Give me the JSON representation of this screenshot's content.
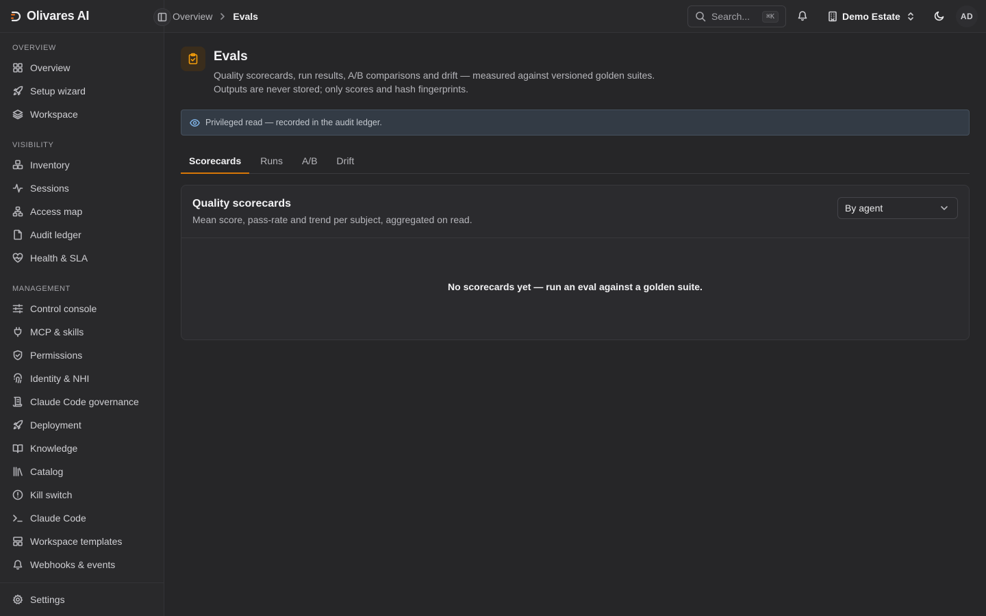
{
  "brand": {
    "name": "Olivares AI"
  },
  "sidebar": {
    "sections": [
      {
        "label": "OVERVIEW",
        "items": [
          {
            "label": "Overview",
            "icon": "grid-icon"
          },
          {
            "label": "Setup wizard",
            "icon": "rocket-icon"
          },
          {
            "label": "Workspace",
            "icon": "layers-icon"
          }
        ]
      },
      {
        "label": "VISIBILITY",
        "items": [
          {
            "label": "Inventory",
            "icon": "boxes-icon"
          },
          {
            "label": "Sessions",
            "icon": "activity-icon"
          },
          {
            "label": "Access map",
            "icon": "network-icon"
          },
          {
            "label": "Audit ledger",
            "icon": "file-icon"
          },
          {
            "label": "Health & SLA",
            "icon": "heart-pulse-icon"
          }
        ]
      },
      {
        "label": "MANAGEMENT",
        "items": [
          {
            "label": "Control console",
            "icon": "sliders-icon"
          },
          {
            "label": "MCP & skills",
            "icon": "plug-icon"
          },
          {
            "label": "Permissions",
            "icon": "shield-icon"
          },
          {
            "label": "Identity & NHI",
            "icon": "fingerprint-icon"
          },
          {
            "label": "Claude Code governance",
            "icon": "scroll-icon"
          },
          {
            "label": "Deployment",
            "icon": "rocket-icon"
          },
          {
            "label": "Knowledge",
            "icon": "book-icon"
          },
          {
            "label": "Catalog",
            "icon": "library-icon"
          },
          {
            "label": "Kill switch",
            "icon": "alert-circle-icon"
          },
          {
            "label": "Claude Code",
            "icon": "terminal-icon"
          },
          {
            "label": "Workspace templates",
            "icon": "layout-icon"
          },
          {
            "label": "Webhooks & events",
            "icon": "bell-icon"
          }
        ]
      }
    ],
    "footer": {
      "label": "Settings",
      "icon": "gear-icon"
    }
  },
  "topbar": {
    "breadcrumbs": [
      "Overview",
      "Evals"
    ],
    "search": {
      "placeholder": "Search...",
      "shortcut": "⌘K"
    },
    "estate": "Demo Estate",
    "avatar": "AD"
  },
  "page": {
    "title": "Evals",
    "description": "Quality scorecards, run results, A/B comparisons and drift — measured against versioned golden suites. Outputs are never stored; only scores and hash fingerprints.",
    "notice": "Privileged read — recorded in the audit ledger.",
    "tabs": [
      {
        "label": "Scorecards",
        "active": true
      },
      {
        "label": "Runs",
        "active": false
      },
      {
        "label": "A/B",
        "active": false
      },
      {
        "label": "Drift",
        "active": false
      }
    ],
    "card": {
      "title": "Quality scorecards",
      "subtitle": "Mean score, pass-rate and trend per subject, aggregated on read.",
      "group_by": "By agent",
      "empty": "No scorecards yet — run an eval against a golden suite."
    }
  },
  "colors": {
    "accent": "#d97706",
    "background": "#262628",
    "sidebar": "#29292b",
    "notice": "#333b45"
  }
}
